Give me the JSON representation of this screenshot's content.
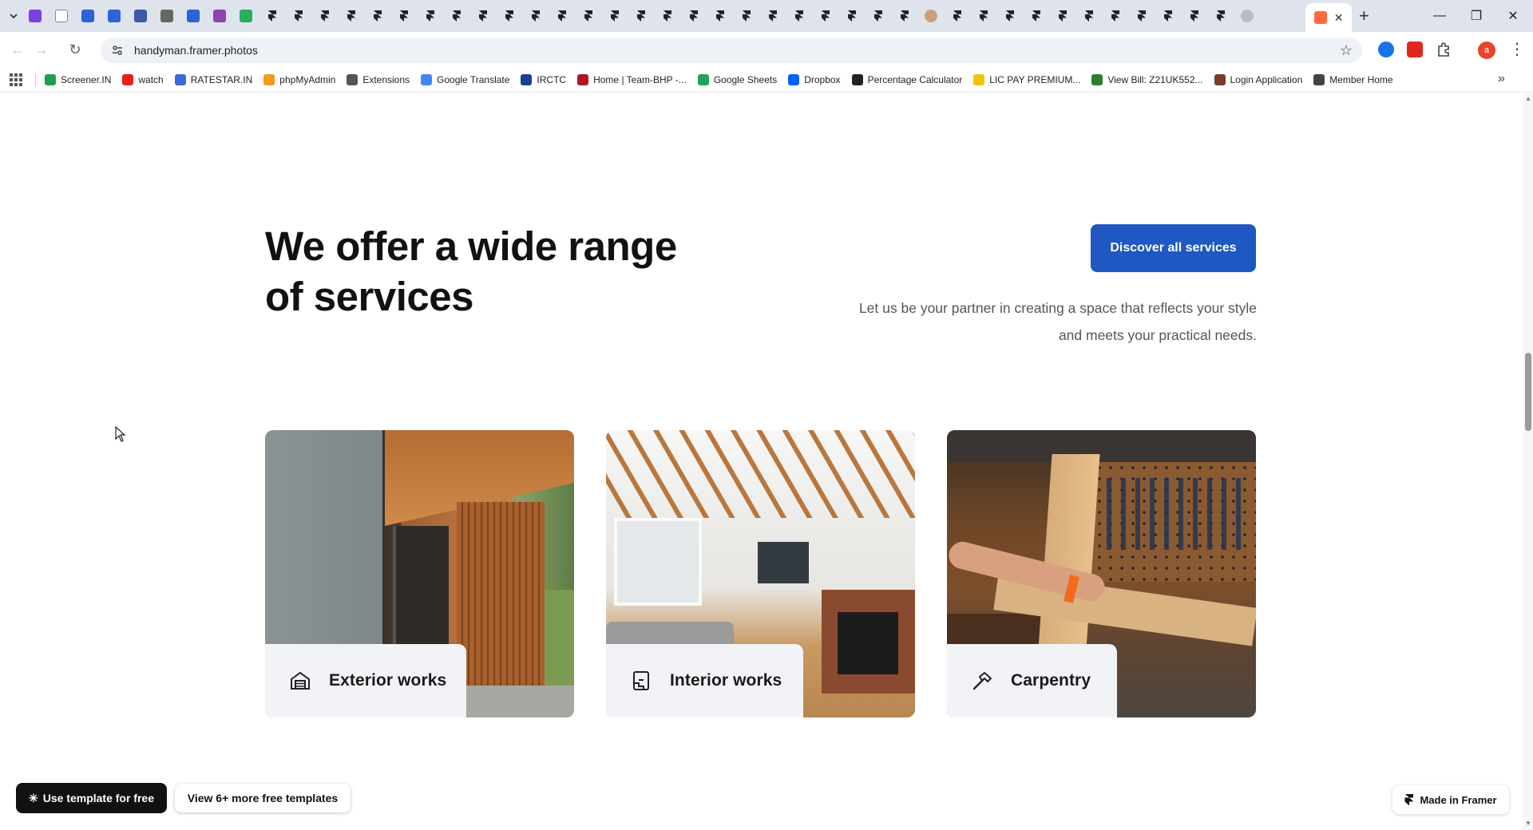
{
  "browser": {
    "url": "handyman.framer.photos",
    "profile_initial": "a",
    "bookmarks": [
      {
        "label": "Screener.IN",
        "icon": "bar-chart-icon",
        "color": "#1e9e4a"
      },
      {
        "label": "watch",
        "icon": "youtube-icon",
        "color": "#e62117"
      },
      {
        "label": "RATESTAR.IN",
        "icon": "ratestar-icon",
        "color": "#3b6bd6"
      },
      {
        "label": "phpMyAdmin",
        "icon": "phpmyadmin-icon",
        "color": "#f29b1e"
      },
      {
        "label": "Extensions",
        "icon": "puzzle-icon",
        "color": "#555555"
      },
      {
        "label": "Google Translate",
        "icon": "translate-icon",
        "color": "#4285f4"
      },
      {
        "label": "IRCTC",
        "icon": "irctc-icon",
        "color": "#1b3f8f"
      },
      {
        "label": "Home | Team-BHP -...",
        "icon": "teambhp-icon",
        "color": "#b3122b"
      },
      {
        "label": "Google Sheets",
        "icon": "sheets-icon",
        "color": "#1ea362"
      },
      {
        "label": "Dropbox",
        "icon": "dropbox-icon",
        "color": "#0061fe"
      },
      {
        "label": "Percentage Calculator",
        "icon": "percent-icon",
        "color": "#222222"
      },
      {
        "label": "LIC PAY PREMIUM...",
        "icon": "lic-icon",
        "color": "#f2c200"
      },
      {
        "label": "View Bill: Z21UK552...",
        "icon": "bill-icon",
        "color": "#2e7d32"
      },
      {
        "label": "Login Application",
        "icon": "login-icon",
        "color": "#7a3b2e"
      },
      {
        "label": "Member Home",
        "icon": "globe-icon",
        "color": "#444444"
      }
    ]
  },
  "hero": {
    "headline": "We offer a wide range of services",
    "cta_label": "Discover all services",
    "tagline": "Let us be your partner in creating a space that reflects your style and meets your practical needs."
  },
  "services": [
    {
      "label": "Exterior works",
      "icon": "house-icon"
    },
    {
      "label": "Interior works",
      "icon": "interior-icon"
    },
    {
      "label": "Carpentry",
      "icon": "hammer-icon"
    }
  ],
  "framer_bar": {
    "use_template": "Use template for free",
    "view_more": "View 6+ more free templates",
    "made_in": "Made in Framer"
  },
  "colors": {
    "accent": "#1f57c3",
    "card_label_bg": "#f2f3f7",
    "headline": "#111111",
    "tagline": "#555555"
  }
}
